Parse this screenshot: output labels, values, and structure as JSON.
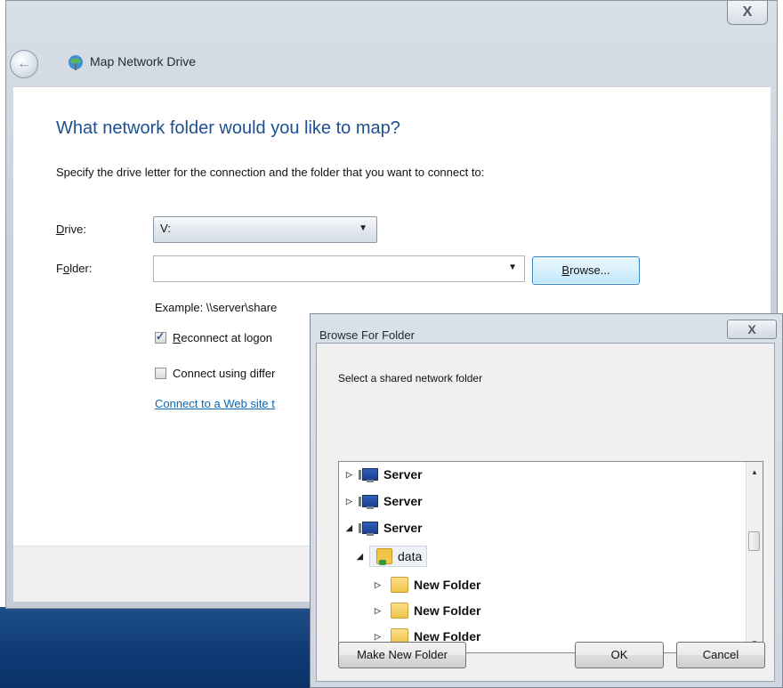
{
  "main_dialog": {
    "title": "Map Network Drive",
    "close_glyph": "X",
    "heading": "What network folder would you like to map?",
    "instruction": "Specify the drive letter for the connection and the folder that you want to connect to:",
    "drive_label_underlined": "D",
    "drive_label_rest": "rive:",
    "drive_value": "V:",
    "folder_label_first": "F",
    "folder_label_underlined": "o",
    "folder_label_rest": "lder:",
    "folder_value": "",
    "browse_underlined": "B",
    "browse_rest": "rowse...",
    "example": "Example: \\\\server\\share",
    "reconnect_underlined": "R",
    "reconnect_rest": "econnect at logon",
    "reconnect_checked": true,
    "connect_different": "Connect using differ",
    "connect_different_checked": false,
    "web_link": "Connect to a Web site t"
  },
  "browse_dialog": {
    "title": "Browse For Folder",
    "close_glyph": "X",
    "description": "Select a shared network folder",
    "tree": [
      {
        "label": "Server",
        "type": "server",
        "expanded": false
      },
      {
        "label": "Server",
        "type": "server",
        "expanded": false
      },
      {
        "label": "Server",
        "type": "server",
        "expanded": true
      },
      {
        "label": "data",
        "type": "share",
        "expanded": true,
        "selected": true
      },
      {
        "label": "New Folder",
        "type": "folder",
        "expanded": false
      },
      {
        "label": "New Folder",
        "type": "folder",
        "expanded": false
      },
      {
        "label": "New Folder",
        "type": "folder",
        "expanded": false
      }
    ],
    "make_new_folder": "Make New Folder",
    "ok": "OK",
    "cancel": "Cancel"
  },
  "icons": {
    "back": "back-arrow-icon",
    "title": "network-drive-icon",
    "server": "computer-icon",
    "share": "shared-folder-icon",
    "folder": "folder-icon"
  }
}
